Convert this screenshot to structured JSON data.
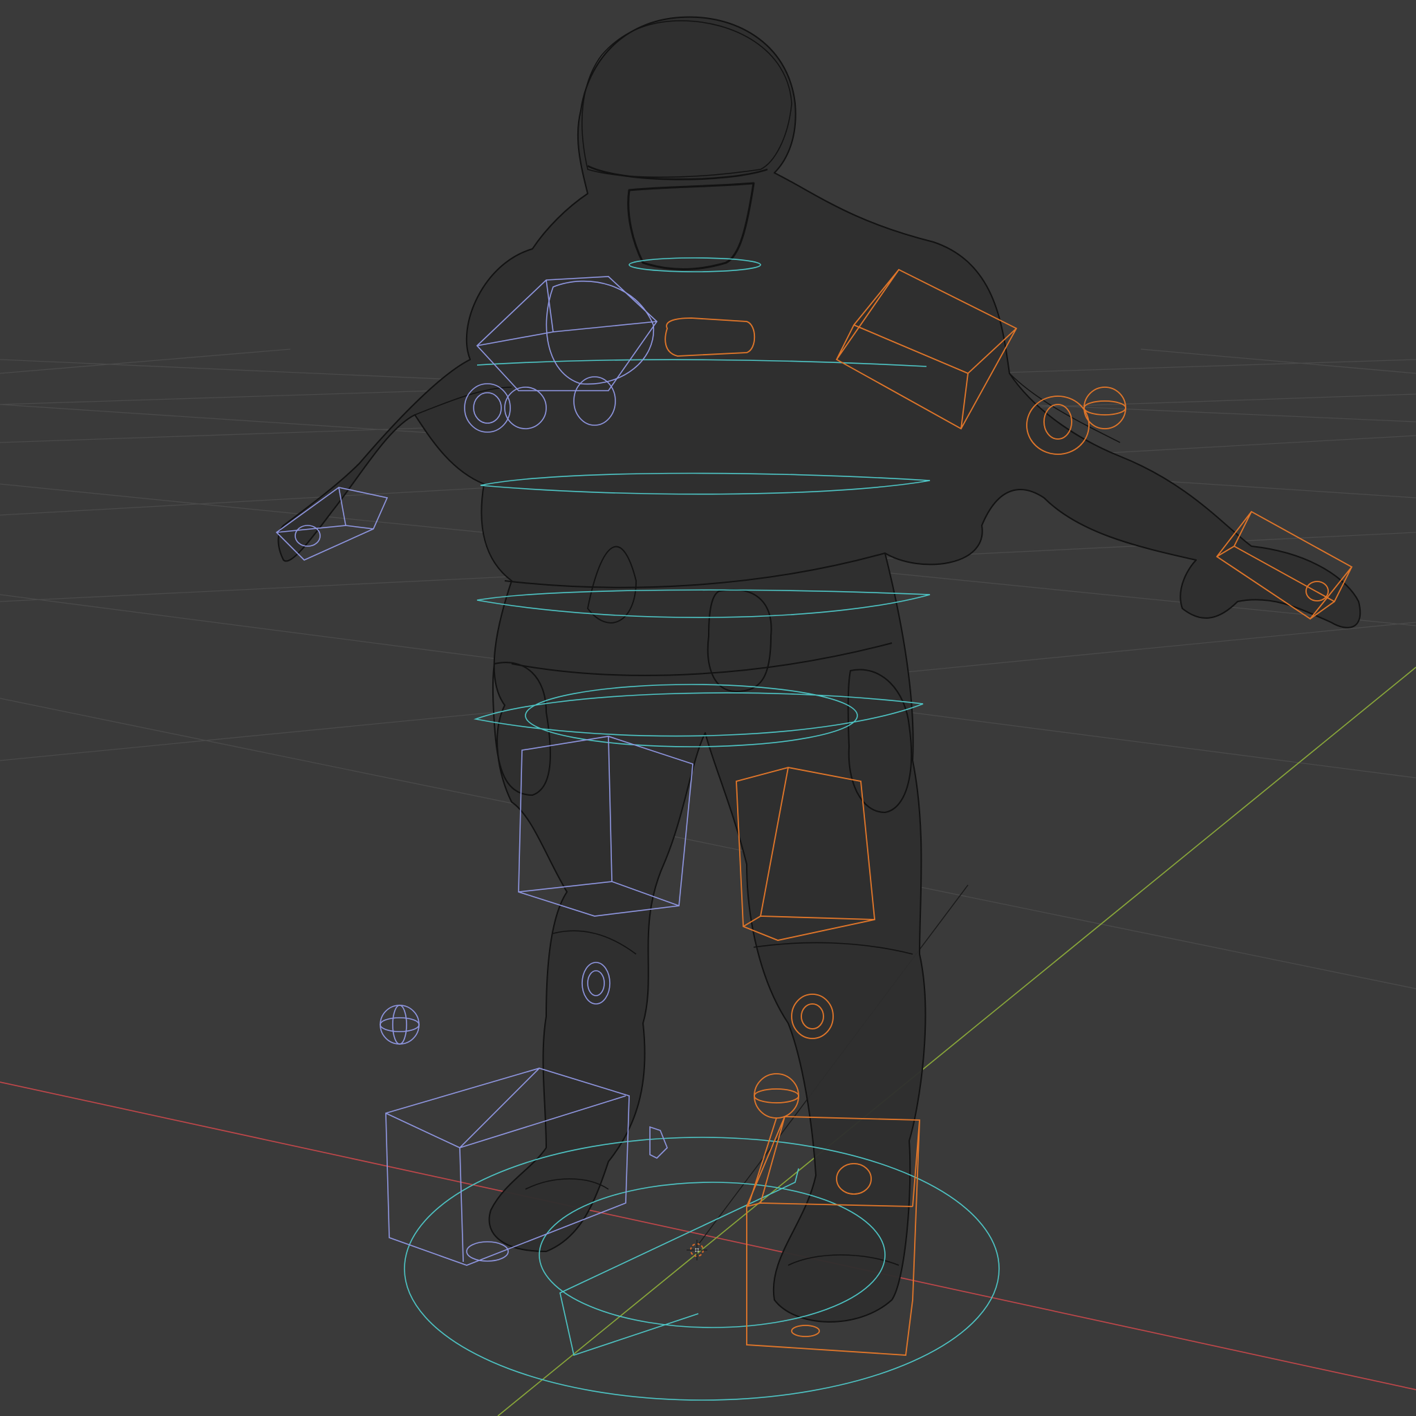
{
  "viewport": {
    "mode": "wireframe",
    "background": "#3a3a3a",
    "grid_color": "#4a4a4a",
    "axis_x_color": "#c0474a",
    "axis_y_color": "#8aa83a"
  },
  "scene": {
    "object": "character-mesh-wireframe",
    "mesh_wire_color": "#121212",
    "controls": {
      "left_side_color": "#8f96e0",
      "right_side_color": "#e0762a",
      "center_color": "#4ec4c4"
    },
    "icons": [
      "3d-cursor-icon",
      "empty-axes-icon"
    ]
  }
}
